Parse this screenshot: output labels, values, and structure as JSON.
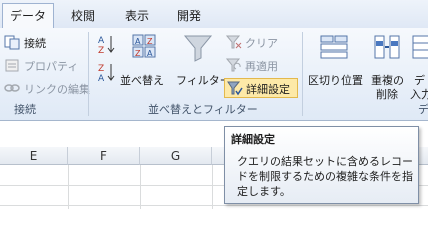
{
  "tabs": [
    {
      "label": "データ",
      "active": true
    },
    {
      "label": "校閲"
    },
    {
      "label": "表示"
    },
    {
      "label": "開発"
    }
  ],
  "connections": {
    "items": [
      {
        "label": "接続",
        "enabled": true
      },
      {
        "label": "プロパティ",
        "enabled": false
      },
      {
        "label": "リンクの編集",
        "enabled": false
      }
    ],
    "group_label": "接続"
  },
  "sort_filter": {
    "sort_label": "並べ替え",
    "filter_label": "フィルター",
    "clear_label": "クリア",
    "reapply_label": "再適用",
    "advanced_label": "詳細設定",
    "group_label": "並べ替えとフィルター"
  },
  "data_tools": {
    "text_to_columns": "区切り位置",
    "remove_duplicates_line1": "重複の",
    "remove_duplicates_line2": "削除",
    "data_validation_line1": "デ",
    "data_validation_line2": "入力",
    "group_label_partial": "デ"
  },
  "sheet": {
    "columns": [
      "E",
      "F",
      "G"
    ]
  },
  "tooltip": {
    "title": "詳細設定",
    "body": "クエリの結果セットに含めるレコードを制限するための複雑な条件を指定します。"
  },
  "colors": {
    "accent": "#2b579a",
    "ribbon_bg": "#dfe9f6",
    "tooltip_border": "#7f8fa6"
  }
}
